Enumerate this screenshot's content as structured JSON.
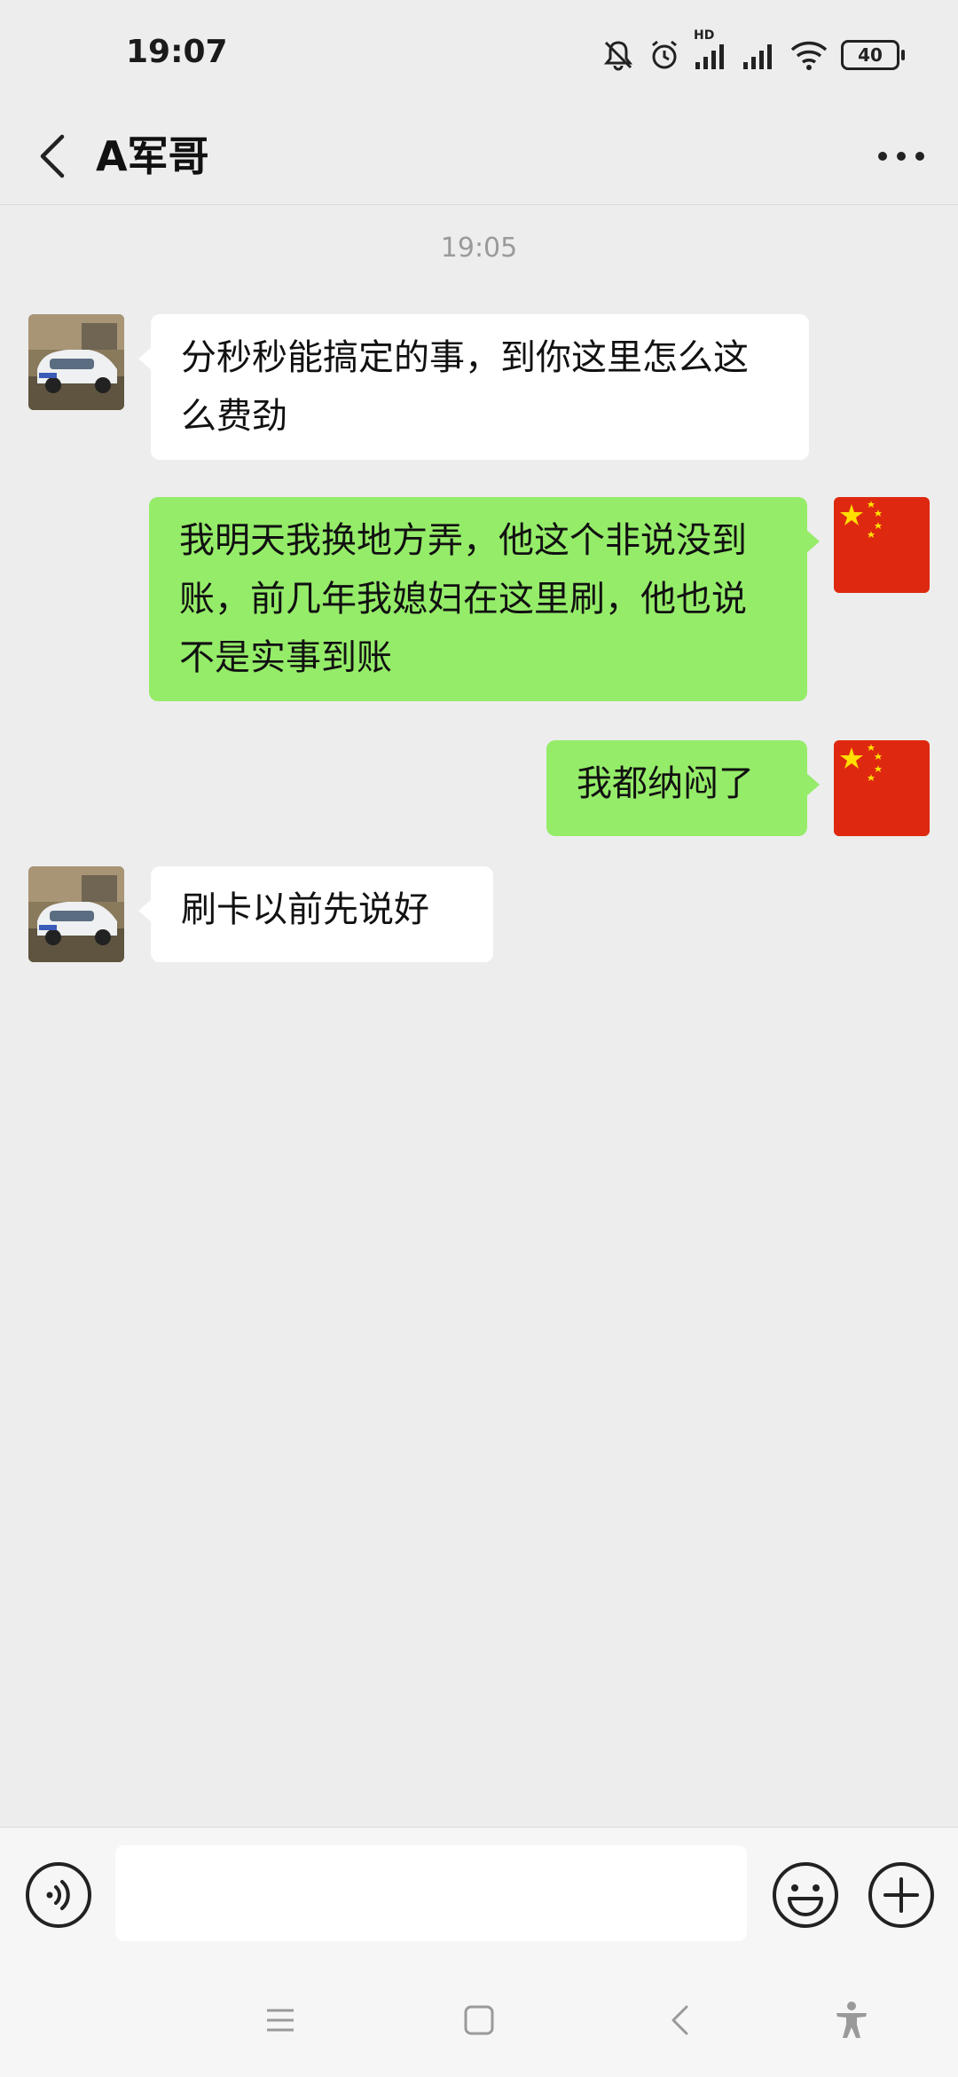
{
  "status_bar": {
    "time": "19:07",
    "network_label": "HD",
    "battery_level": "40",
    "icons": [
      "mute-bell-icon",
      "alarm-icon",
      "signal-icon",
      "signal-icon",
      "wifi-icon",
      "battery-icon"
    ]
  },
  "header": {
    "title": "A军哥",
    "back_icon": "chevron-left-icon",
    "more_icon": "more-dots-icon"
  },
  "chat": {
    "timestamp": "19:05",
    "messages": [
      {
        "side": "in",
        "text": "分秒秒能搞定的事，到你这里怎么这么费劲"
      },
      {
        "side": "out",
        "text": "我明天我换地方弄，他这个非说没到账，前几年我媳妇在这里刷，他也说不是实事到账"
      },
      {
        "side": "out",
        "text": "我都纳闷了"
      },
      {
        "side": "in",
        "text": "刷卡以前先说好"
      }
    ]
  },
  "input_bar": {
    "voice_icon": "voice-icon",
    "input_value": "",
    "emoji_icon": "emoji-icon",
    "plus_icon": "plus-icon"
  },
  "nav_bar": {
    "icons": [
      "menu-icon",
      "home-icon",
      "back-icon",
      "accessibility-icon"
    ]
  },
  "colors": {
    "background": "#ededed",
    "bubble_out": "#95ec69",
    "bubble_in": "#ffffff"
  }
}
